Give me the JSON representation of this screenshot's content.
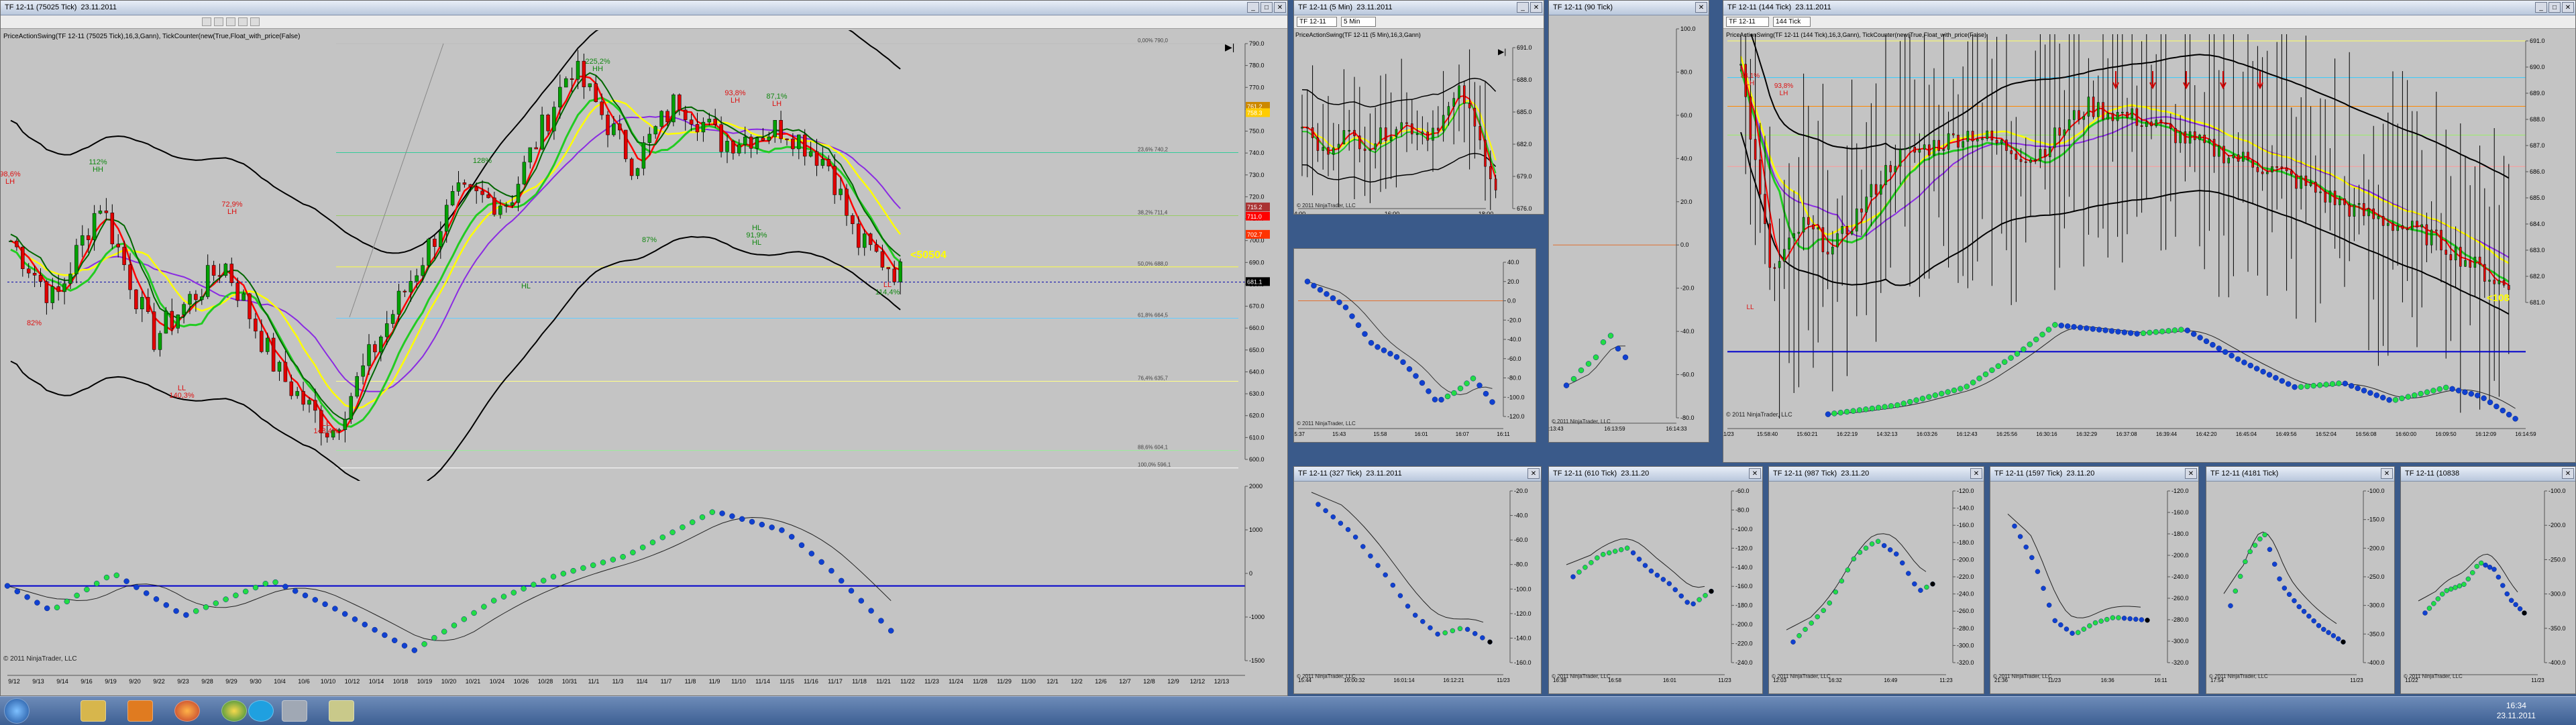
{
  "main_window": {
    "title": "TF 12-11 (75025 Tick)",
    "date": "23.11.2011",
    "indicator_line": "PriceActionSwing(TF 12-11 (75025 Tick),16,3,Gann), TickCounter(new(True,Float_with_price(False)",
    "copyright": "© 2011 NinjaTrader, LLC",
    "swing_labels": [
      "225,2%",
      "HH",
      "112%",
      "HH",
      "72,9%",
      "LH",
      "98,6%",
      "LH",
      "87,1%",
      "LH",
      "128%",
      "93,8%",
      "LH",
      "87%",
      "HL",
      "91,9%",
      "HL",
      "LL",
      "140,3%",
      "LL",
      "148,4%",
      "HL",
      "82%",
      "LL",
      "114,4%"
    ],
    "callout": "<50504",
    "price_axis": [
      "790.0",
      "780.0",
      "770.0",
      "760.0",
      "750.0",
      "740.0",
      "730.0",
      "720.0",
      "710.0",
      "700.0",
      "690.0",
      "680.0",
      "670.0",
      "660.0",
      "650.0",
      "640.0",
      "630.0",
      "620.0",
      "610.0",
      "600.0"
    ],
    "price_marks": [
      "761.2",
      "758.3",
      "715.2",
      "711.0",
      "702.7",
      "681.1"
    ],
    "osc_axis": [
      "2000",
      "1000",
      "0",
      "-1000",
      "-1500"
    ],
    "date_axis": [
      "9/12",
      "9/13",
      "9/14",
      "9/16",
      "9/19",
      "9/20",
      "9/22",
      "9/23",
      "9/28",
      "9/29",
      "9/30",
      "10/4",
      "10/6",
      "10/10",
      "10/12",
      "10/14",
      "10/18",
      "10/19",
      "10/20",
      "10/21",
      "10/24",
      "10/26",
      "10/28",
      "10/31",
      "11/1",
      "11/3",
      "11/4",
      "11/7",
      "11/8",
      "11/9",
      "11/10",
      "11/14",
      "11/15",
      "11/16",
      "11/17",
      "11/18",
      "11/21",
      "11/22",
      "11/23",
      "11/24",
      "11/28",
      "11/29",
      "11/30",
      "12/1",
      "12/2",
      "12/6",
      "12/7",
      "12/8",
      "12/9",
      "12/12",
      "12/13"
    ],
    "fib_labels": [
      "0,00% 790,0",
      "23,6% 740,2",
      "38,2% 711,4",
      "50,0% 688,0",
      "61,8% 664,5",
      "76,4% 635,7",
      "88,6% 604,1",
      "100,0% 596,1"
    ]
  },
  "win_5min": {
    "title": "TF 12-11 (5 Min)",
    "date": "23.11.2011",
    "toolbar_select": "TF 12-11",
    "toolbar_select2": "5 Min",
    "indicator_line": "PriceActionSwing(TF 12-11 (5 Min),16,3,Gann)",
    "price_axis": [
      "691.0",
      "688.0",
      "685.0",
      "682.0",
      "679.0",
      "676.0"
    ],
    "time_axis": [
      "14:00",
      "16:00",
      "18:00"
    ],
    "copyright": "© 2011 NinjaTrader, LLC"
  },
  "win_90tick": {
    "title": "TF 12-11 (90 Tick)",
    "axis": [
      "100.0",
      "80.0",
      "60.0",
      "40.0",
      "20.0",
      "0.0",
      "-20.0",
      "-40.0",
      "-60.0",
      "-80.0"
    ],
    "time_axis": [
      "16:13:43",
      "16:13:59",
      "16:14:33"
    ],
    "copyright": "© 2011 NinjaTrader, LLC"
  },
  "win_144tick": {
    "title": "TF 12-11 (144 Tick)",
    "date": "23.11.2011",
    "toolbar_select": "TF 12-11",
    "toolbar_select2": "144 Tick",
    "indicator_line": "PriceActionSwing(TF 12-11 (144 Tick),16,3,Gann), TickCounter(new(True,Float_with_price(False)",
    "swing_labels": [
      "84,1%",
      "LH",
      "93,8%",
      "LH",
      "LL"
    ],
    "callout": "<108",
    "price_axis": [
      "691.0",
      "690.0",
      "689.0",
      "688.0",
      "687.0",
      "686.0",
      "685.0",
      "684.0",
      "683.0",
      "682.0",
      "681.0"
    ],
    "time_axis": [
      "11/23",
      "15:58:40",
      "15:60:21",
      "16:22:19",
      "14:32:13",
      "16:03:26",
      "16:12:43",
      "16:25:56",
      "16:30:16",
      "16:32:29",
      "16:37:08",
      "16:39:44",
      "16:42:20",
      "16:45:04",
      "16:49:56",
      "16:52:04",
      "16:56:08",
      "16:60:00",
      "16:09:50",
      "16:12:09",
      "16:14:59"
    ],
    "copyright": "© 2011 NinjaTrader, LLC"
  },
  "win_15min_osc": {
    "time_axis": [
      "15:37",
      "15:43",
      "15:58",
      "16:01",
      "16:07",
      "16:11"
    ],
    "axis": [
      "40.0",
      "20.0",
      "0.0",
      "-20.0",
      "-40.0",
      "-60.0",
      "-80.0",
      "-100.0",
      "-120.0"
    ],
    "copyright": "© 2011 NinjaTrader, LLC"
  },
  "small_windows": [
    {
      "title": "TF 12-11 (327 Tick)",
      "date": "23.11.2011",
      "axis": [
        "-20.0",
        "-40.0",
        "-60.0",
        "-80.0",
        "-100.0",
        "-120.0",
        "-140.0",
        "-160.0"
      ],
      "time_axis": [
        "15:44",
        "16:00:32",
        "16:01:14",
        "16:12:21",
        "11/23"
      ],
      "copyright": "© 2011 NinjaTrader, LLC"
    },
    {
      "title": "TF 12-11 (610 Tick)",
      "date": "23.11.20",
      "axis": [
        "-60.0",
        "-80.0",
        "-100.0",
        "-120.0",
        "-140.0",
        "-160.0",
        "-180.0",
        "-200.0",
        "-220.0",
        "-240.0"
      ],
      "time_axis": [
        "16:38",
        "16:58",
        "16:01",
        "11/23"
      ],
      "copyright": "© 2011 NinjaTrader, LLC"
    },
    {
      "title": "TF 12-11 (987 Tick)",
      "date": "23.11.20",
      "axis": [
        "-120.0",
        "-140.0",
        "-160.0",
        "-180.0",
        "-200.0",
        "-220.0",
        "-240.0",
        "-260.0",
        "-280.0",
        "-300.0",
        "-320.0"
      ],
      "time_axis": [
        "12:03",
        "16:32",
        "16:49",
        "11:23"
      ],
      "copyright": "© 2011 NinjaTrader, LLC"
    },
    {
      "title": "TF 12-11 (1597 Tick)",
      "date": "23.11.20",
      "axis": [
        "-120.0",
        "-160.0",
        "-180.0",
        "-200.0",
        "-240.0",
        "-260.0",
        "-280.0",
        "-300.0",
        "-320.0"
      ],
      "time_axis": [
        "21:36",
        "11/23",
        "16:36",
        "16:11"
      ],
      "copyright": "© 2011 NinjaTrader, LLC"
    },
    {
      "title": "TF 12-11 (4181 Tick)",
      "date": "",
      "axis": [
        "-100.0",
        "-150.0",
        "-200.0",
        "-250.0",
        "-300.0",
        "-350.0",
        "-400.0"
      ],
      "time_axis": [
        "17:54",
        "11/23"
      ],
      "copyright": "© 2011 NinjaTrader, LLC"
    },
    {
      "title": "TF 12-11 (10838",
      "date": "",
      "axis": [
        "-100.0",
        "-200.0",
        "-250.0",
        "-300.0",
        "-350.0",
        "-400.0"
      ],
      "time_axis": [
        "11/22",
        "11/23"
      ],
      "copyright": "© 2011 NinjaTrader, LLC"
    }
  ],
  "taskbar": {
    "time": "16:34",
    "date": "23.11.2011",
    "icons": [
      "start-icon",
      "explorer-icon",
      "media-player-icon",
      "firefox-icon",
      "chrome-icon",
      "skype-icon",
      "ninjatrader-icon",
      "notepad-icon"
    ]
  },
  "colors": {
    "bg": "#c4c4c4",
    "up_candle": "#00a000",
    "down_candle": "#e00000",
    "ma_red": "#ff0000",
    "ma_green": "#22cc22",
    "ma_yellow": "#ffff00",
    "ma_purple": "#8a2be2",
    "band": "#000000",
    "osc_dot": "#1040d0",
    "zero_line": "#0000cc"
  }
}
